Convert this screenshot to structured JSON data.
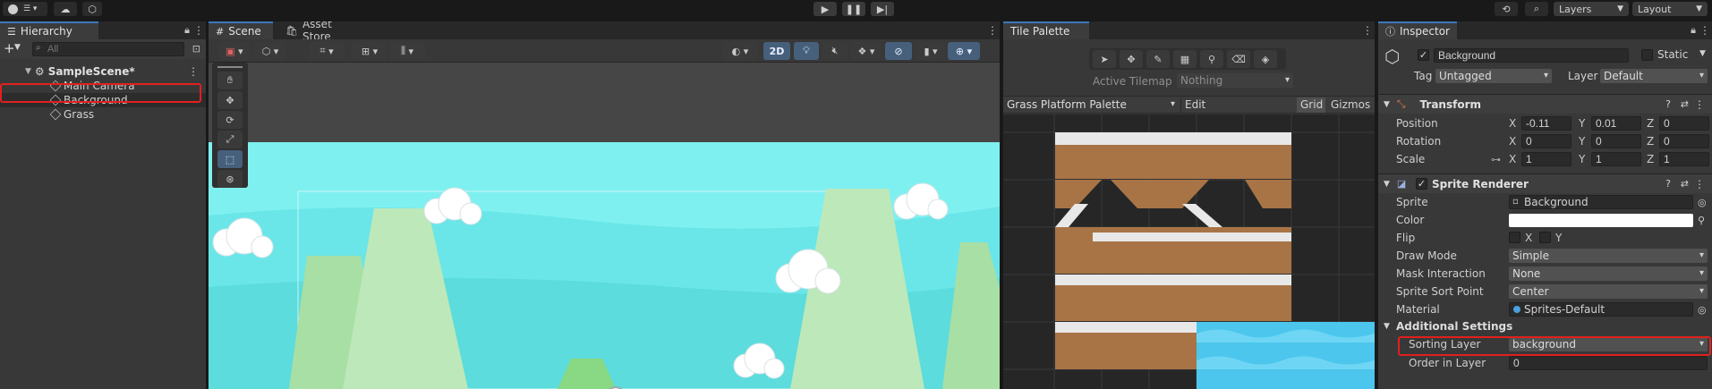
{
  "toolbar": {
    "layers_label": "Layers",
    "layout_label": "Layout"
  },
  "hierarchy": {
    "tab": "Hierarchy",
    "search_placeholder": "All",
    "add_label": "+",
    "scene": "SampleScene*",
    "items": [
      "Main Camera",
      "Background",
      "Grass"
    ]
  },
  "scene_view": {
    "tab_scene": "Scene",
    "tab_asset_store": "Asset Store",
    "mode_2d": "2D"
  },
  "tile_palette": {
    "tab": "Tile Palette",
    "active_tilemap_label": "Active Tilemap",
    "active_tilemap_value": "Nothing",
    "palette_name": "Grass Platform Palette",
    "edit_label": "Edit",
    "grid_label": "Grid",
    "gizmos_label": "Gizmos"
  },
  "inspector": {
    "tab": "Inspector",
    "object_name": "Background",
    "static_label": "Static",
    "tag_label": "Tag",
    "tag_value": "Untagged",
    "layer_label": "Layer",
    "layer_value": "Default",
    "transform": {
      "title": "Transform",
      "position_label": "Position",
      "rotation_label": "Rotation",
      "scale_label": "Scale",
      "position": {
        "x": "-0.11",
        "y": "0.01",
        "z": "0"
      },
      "rotation": {
        "x": "0",
        "y": "0",
        "z": "0"
      },
      "scale": {
        "x": "1",
        "y": "1",
        "z": "1"
      }
    },
    "sprite_renderer": {
      "title": "Sprite Renderer",
      "sprite_label": "Sprite",
      "sprite_value": "Background",
      "color_label": "Color",
      "flip_label": "Flip",
      "flip_x": "X",
      "flip_y": "Y",
      "draw_mode_label": "Draw Mode",
      "draw_mode_value": "Simple",
      "mask_label": "Mask Interaction",
      "mask_value": "None",
      "sort_point_label": "Sprite Sort Point",
      "sort_point_value": "Center",
      "material_label": "Material",
      "material_value": "Sprites-Default",
      "additional_label": "Additional Settings",
      "sorting_layer_label": "Sorting Layer",
      "sorting_layer_value": "background",
      "order_label": "Order in Layer",
      "order_value": "0"
    }
  },
  "axes": {
    "x": "X",
    "y": "Y",
    "z": "Z"
  },
  "colors": {
    "accent": "#3a79bb",
    "highlight": "#e21f1f",
    "sky": "#7ff0f0"
  }
}
